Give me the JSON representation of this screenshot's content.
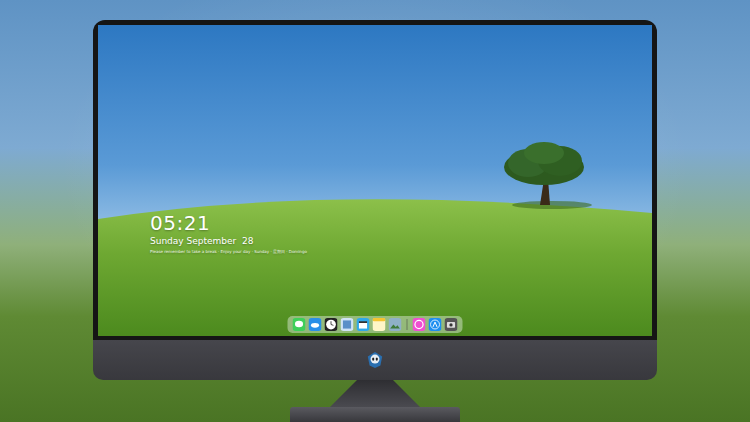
{
  "desktop": {
    "clock": {
      "time": "05:21",
      "date": "Sunday September  28",
      "quote": "Please remember to take a break · Enjoy your day · Sunday · 星期日 · Domingo"
    }
  }
}
